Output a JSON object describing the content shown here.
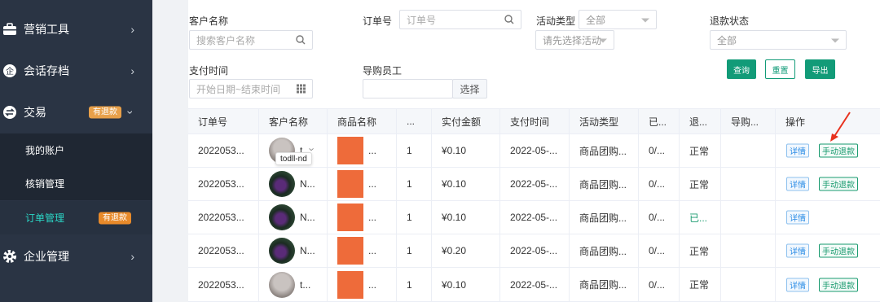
{
  "sidebar": {
    "items": [
      {
        "label": "营销工具",
        "icon": "briefcase-icon"
      },
      {
        "label": "会话存档",
        "icon": "chat-icon"
      },
      {
        "label": "交易",
        "icon": "transfer-icon",
        "badge": "有退款"
      },
      {
        "label": "我的账户"
      },
      {
        "label": "核销管理"
      },
      {
        "label": "订单管理",
        "badge": "有退款"
      },
      {
        "label": "企业管理",
        "icon": "gear-icon"
      }
    ]
  },
  "filters": {
    "customer_name": {
      "label": "客户名称",
      "placeholder": "搜索客户名称"
    },
    "order_no": {
      "label": "订单号",
      "placeholder": "订单号"
    },
    "activity_type": {
      "label": "活动类型",
      "value": "全部",
      "sub_placeholder": "请先选择活动"
    },
    "refund_status": {
      "label": "退款状态",
      "value": "全部"
    },
    "pay_time": {
      "label": "支付时间",
      "placeholder": "开始日期~结束时间"
    },
    "guide_staff": {
      "label": "导购员工",
      "select_button": "选择"
    }
  },
  "buttons": {
    "query": "查询",
    "reset": "重置",
    "export": "导出"
  },
  "table": {
    "headers": [
      "订单号",
      "客户名称",
      "商品名称",
      "...",
      "实付金额",
      "支付时间",
      "活动类型",
      "已...",
      "退...",
      "导购...",
      "操作"
    ],
    "rows": [
      {
        "order_no": "2022053...",
        "customer": "t...",
        "product": "...",
        "qty": "1",
        "amount": "¥0.10",
        "pay_time": "2022-05-...",
        "activity": "商品团购...",
        "c7": "0/...",
        "refund": "正常",
        "actions": [
          "详情",
          "手动退款"
        ]
      },
      {
        "order_no": "2022053...",
        "customer": "N...",
        "product": "...",
        "qty": "1",
        "amount": "¥0.10",
        "pay_time": "2022-05-...",
        "activity": "商品团购...",
        "c7": "0/...",
        "refund": "正常",
        "actions": [
          "详情",
          "手动退款"
        ]
      },
      {
        "order_no": "2022053...",
        "customer": "N...",
        "product": "...",
        "qty": "1",
        "amount": "¥0.10",
        "pay_time": "2022-05-...",
        "activity": "商品团购...",
        "c7": "0/...",
        "refund": "已...",
        "actions": [
          "详情"
        ]
      },
      {
        "order_no": "2022053...",
        "customer": "N...",
        "product": "...",
        "qty": "1",
        "amount": "¥0.20",
        "pay_time": "2022-05-...",
        "activity": "商品团购...",
        "c7": "0/...",
        "refund": "正常",
        "actions": [
          "详情",
          "手动退款"
        ]
      },
      {
        "order_no": "2022053...",
        "customer": "t...",
        "product": "...",
        "qty": "1",
        "amount": "¥0.10",
        "pay_time": "2022-05-...",
        "activity": "商品团购...",
        "c7": "0/...",
        "refund": "正常",
        "actions": [
          "详情",
          "手动退款"
        ]
      }
    ]
  },
  "tooltip": "todll-nd",
  "colors": {
    "sidebar_bg": "#2a3444",
    "accent_green": "#129b78",
    "active_teal": "#2bd6c6",
    "badge_orange": "#e8a04a",
    "annotation_red": "#e8321e"
  }
}
